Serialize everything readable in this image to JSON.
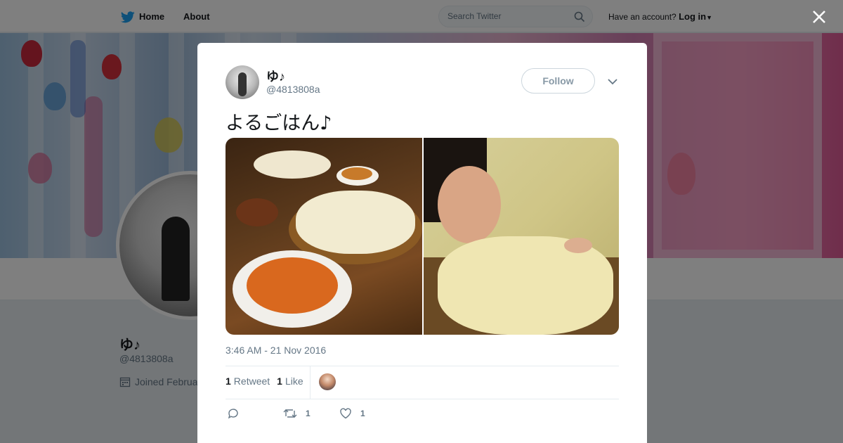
{
  "nav": {
    "home_label": "Home",
    "about_label": "About"
  },
  "search": {
    "placeholder": "Search Twitter"
  },
  "account": {
    "prompt": "Have an account?",
    "login_label": "Log in"
  },
  "profile": {
    "name": "ゆ♪",
    "handle": "@4813808a",
    "joined": "Joined Februa"
  },
  "tweet": {
    "author_name": "ゆ♪",
    "author_handle": "@4813808a",
    "follow_label": "Follow",
    "text": "よるごはん♪",
    "timestamp": "3:46 AM - 21 Nov 2016",
    "retweets_count": "1",
    "retweets_label": "Retweet",
    "likes_count": "1",
    "likes_label": "Like",
    "action_retweet_count": "1",
    "action_like_count": "1"
  },
  "colors": {
    "accent": "#1da1f2",
    "text": "#14171a",
    "muted": "#657786"
  }
}
